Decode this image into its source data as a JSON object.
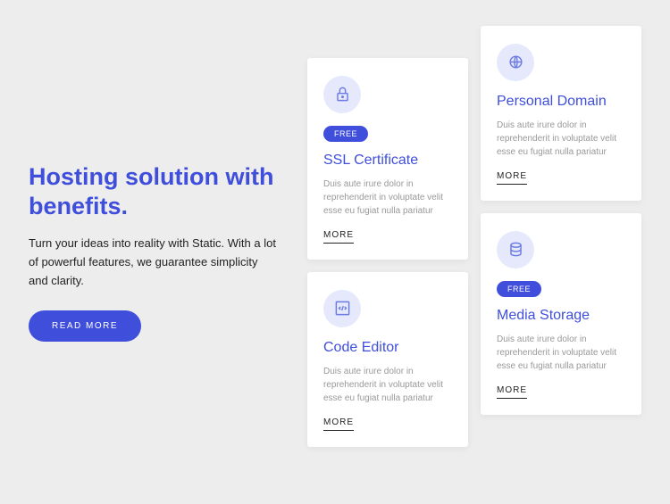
{
  "hero": {
    "heading": "Hosting solution with benefits.",
    "subtext": "Turn your ideas into reality with Static. With a lot of powerful features, we guarantee simplicity and clarity.",
    "button": "READ MORE"
  },
  "cards": [
    {
      "badge": "FREE",
      "title": "SSL Certificate",
      "desc": "Duis aute irure dolor in reprehenderit in voluptate velit esse eu fugiat nulla pariatur",
      "more": "MORE"
    },
    {
      "badge": null,
      "title": "Personal Domain",
      "desc": "Duis aute irure dolor in reprehenderit in voluptate velit esse eu fugiat nulla pariatur",
      "more": "MORE"
    },
    {
      "badge": null,
      "title": "Code Editor",
      "desc": "Duis aute irure dolor in reprehenderit in voluptate velit esse eu fugiat nulla pariatur",
      "more": "MORE"
    },
    {
      "badge": "FREE",
      "title": "Media Storage",
      "desc": "Duis aute irure dolor in reprehenderit in voluptate velit esse eu fugiat nulla pariatur",
      "more": "MORE"
    }
  ]
}
